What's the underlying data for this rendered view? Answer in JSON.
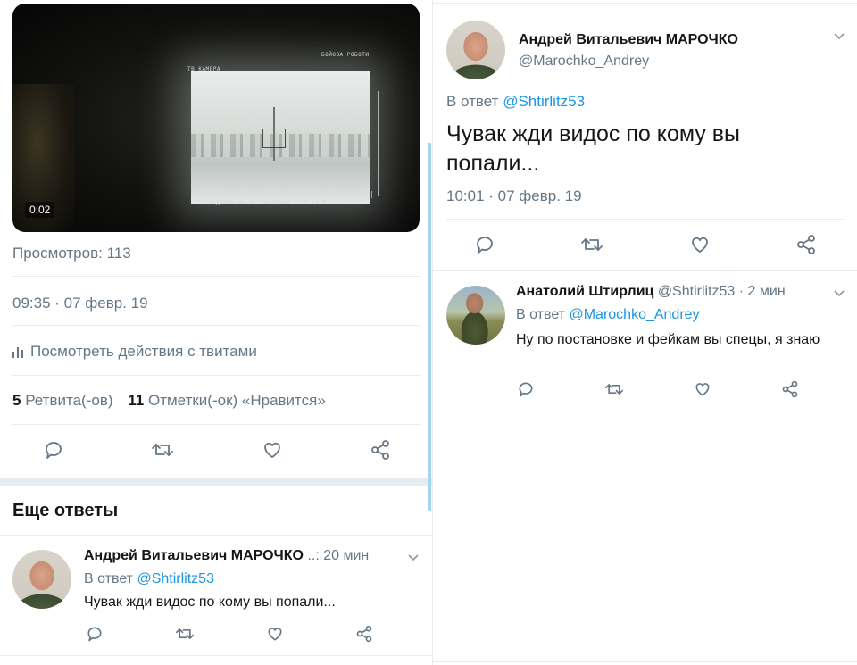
{
  "left": {
    "video": {
      "duration": "0:02",
      "osd_top_left": "TB KAMEPA",
      "osd_top_right": "БОЙОВА РОБОТИ",
      "osd_bottom": "ВІДТИНЬ    ОН  ОС  ХИБЛЕННЯ    12.7   25.7"
    },
    "views": "Просмотров: 113",
    "timestamp": "09:35 · 07 февр. 19",
    "activity_link": "Посмотреть действия с твитами",
    "retweets_count": "5",
    "retweets_label": "Ретвита(-ов)",
    "likes_count": "11",
    "likes_label": "Отметки(-ок) «Нравится»",
    "more_replies_title": "Еще ответы",
    "reply": {
      "name": "Андрей Витальевич МАРОЧКО",
      "ellipsis": "..:",
      "time": "20 мин",
      "reply_prefix": "В ответ",
      "reply_to": "@Shtirlitz53",
      "text": "Чувак жди видос по кому вы попали..."
    }
  },
  "right": {
    "main_tweet": {
      "name": "Андрей Витальевич МАРОЧКО",
      "handle": "@Marochko_Andrey",
      "reply_prefix": "В ответ",
      "reply_to": "@Shtirlitz53",
      "text": "Чувак жди видос по кому вы попали...",
      "timestamp": "10:01 · 07 февр. 19"
    },
    "reply": {
      "name": "Анатолий Штирлиц",
      "handle": "@Shtirlitz53",
      "time": "· 2 мин",
      "reply_prefix": "В ответ",
      "reply_to": "@Marochko_Andrey",
      "text": "Ну по постановке и фейкам вы спецы, я знаю"
    }
  },
  "icons": [
    "reply-icon",
    "retweet-icon",
    "like-icon",
    "share-icon",
    "chevron-down-icon",
    "analytics-icon"
  ],
  "colors": {
    "link": "#1b95e0",
    "muted": "#657786",
    "thread_line": "#a6d5f4",
    "divider": "#e6ecf0"
  }
}
